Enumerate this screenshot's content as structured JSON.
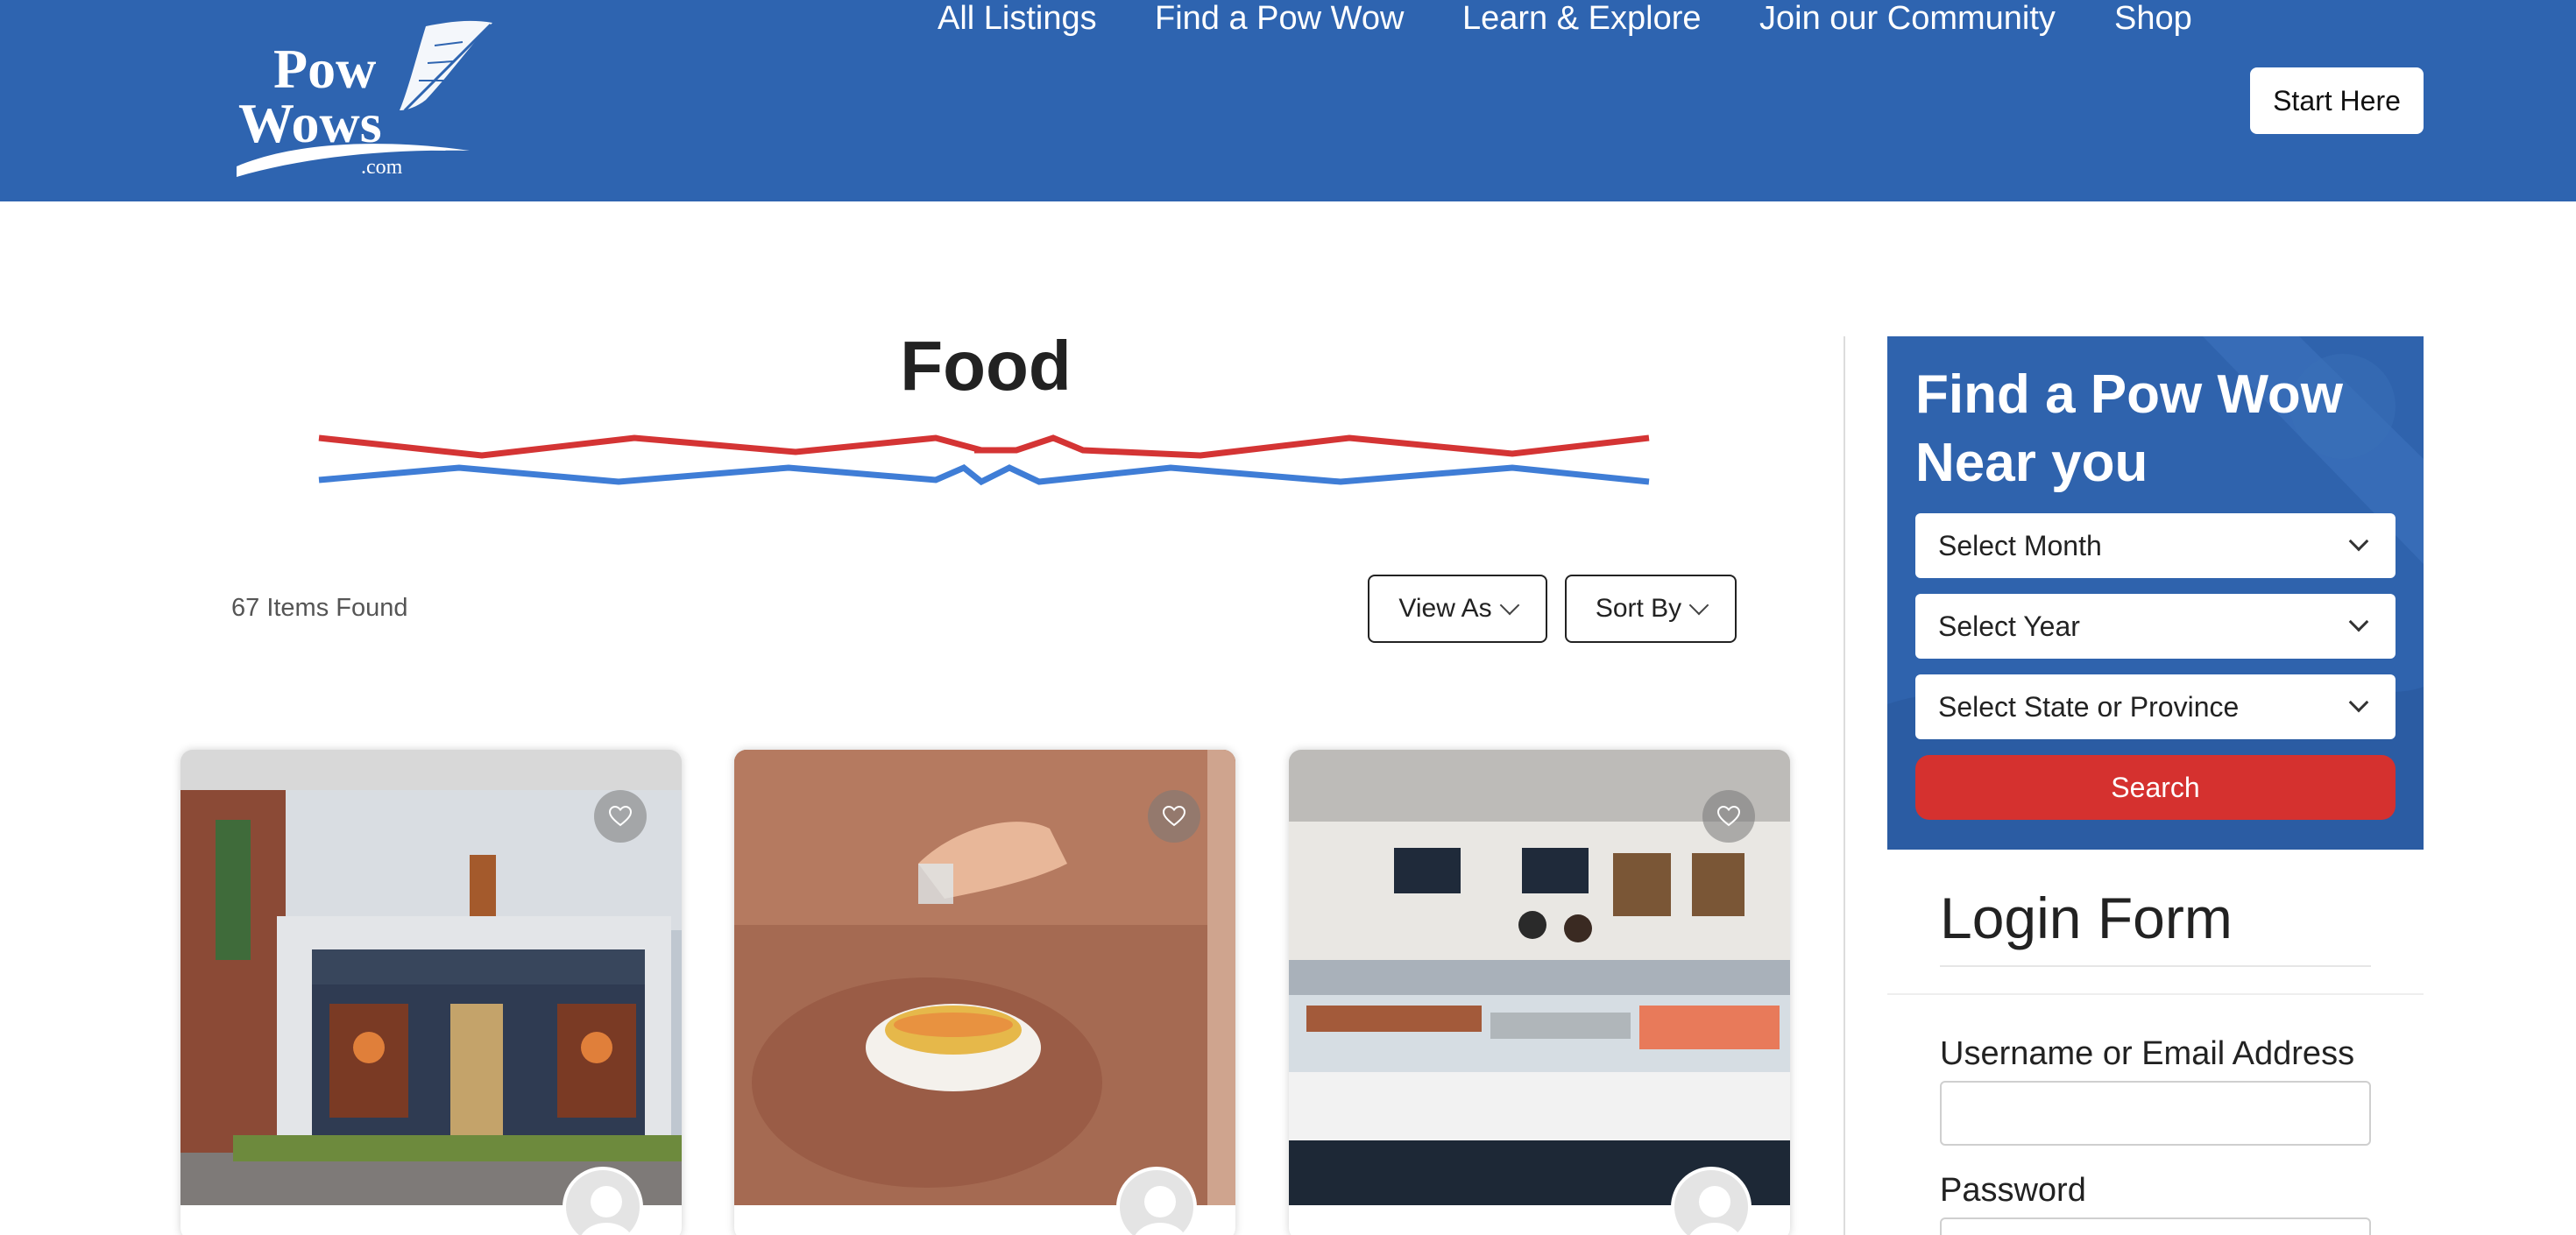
{
  "header": {
    "logo_alt": "PowWows.com",
    "nav": [
      {
        "label": "All Listings"
      },
      {
        "label": "Find a Pow Wow"
      },
      {
        "label": "Learn & Explore"
      },
      {
        "label": "Join our Community"
      },
      {
        "label": "Shop"
      }
    ],
    "start_button": "Start Here",
    "bg_color": "#2e64b0"
  },
  "main": {
    "title": "Food",
    "items_found": "67 Items Found",
    "view_as": "View As",
    "sort_by": "Sort By",
    "cards": [
      {
        "image": "bison-coffeehouse-storefront",
        "favorite_icon": "heart-icon"
      },
      {
        "image": "corn-dish-on-rock",
        "favorite_icon": "heart-icon"
      },
      {
        "image": "seafood-counter-shop",
        "favorite_icon": "heart-icon"
      }
    ]
  },
  "sidebar": {
    "finder": {
      "title": "Find a Pow Wow Near you",
      "month_select": "Select Month",
      "year_select": "Select Year",
      "state_select": "Select State or Province",
      "search_button": "Search",
      "accent_color": "#d5312f"
    },
    "login": {
      "title": "Login Form",
      "username_label": "Username or Email Address",
      "password_label": "Password"
    }
  }
}
